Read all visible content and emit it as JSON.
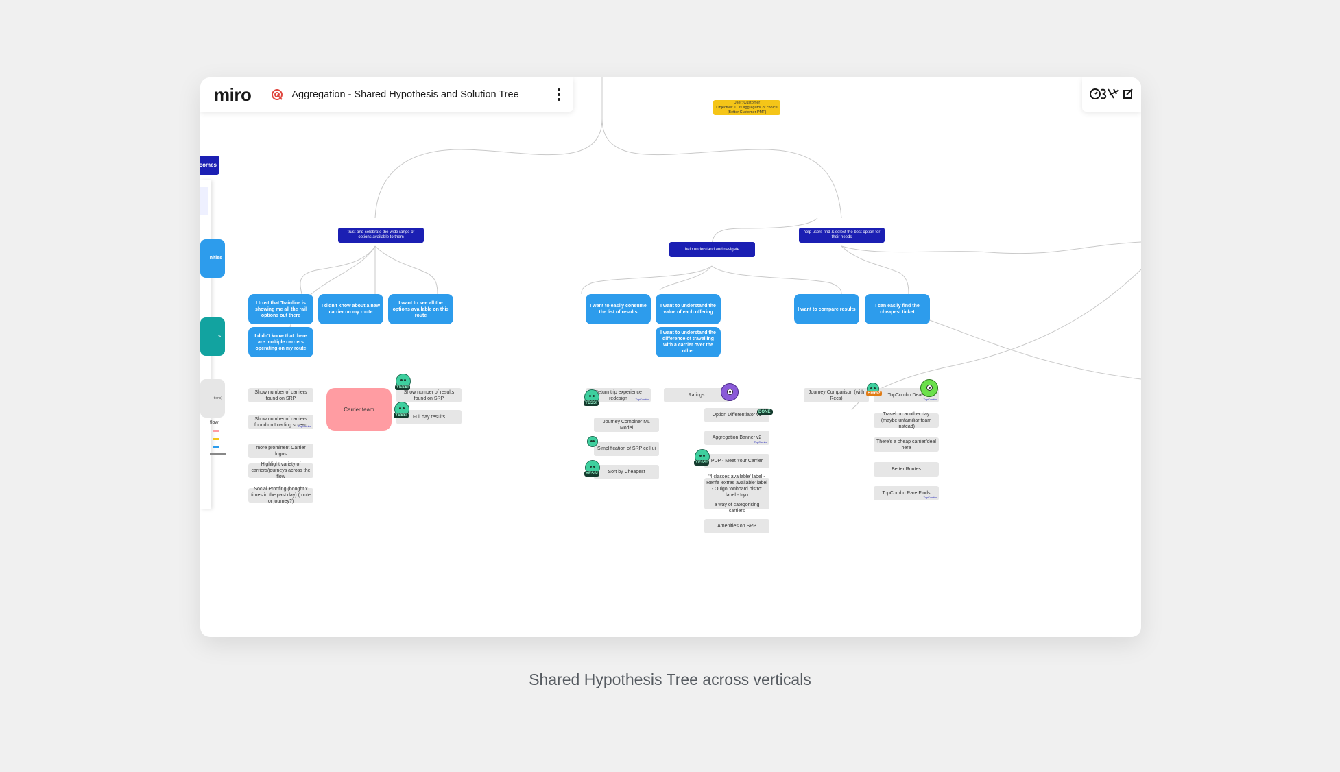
{
  "app": {
    "logo": "miro",
    "board_title": "Aggregation - Shared Hypothesis and Solution Tree",
    "board_icon": "board-icon",
    "menu_icon": "more-vertical-icon",
    "right_tool_icons": [
      "collaborators-icon",
      "share-icon"
    ]
  },
  "colors": {
    "outcome_navy": "#1b1fb3",
    "opportunity_blue": "#2d9cec",
    "root_yellow": "#f5c518",
    "solution_grey": "#e6e6e6",
    "team_pink": "#ff9ca2",
    "left_teal": "#12a3a0"
  },
  "tree": {
    "root": {
      "line1": "User: Customer",
      "line2": "Objective: TL is aggregator of choice",
      "line3": "(Better Customer PMF)"
    },
    "outcomes": {
      "trust": "trust and celebrate the wide range of options available to them",
      "navigate": "help understand and navigate",
      "select": "help users find & select the best option for their needs"
    },
    "opportunities": {
      "o1": "I trust that Trainline is showing me all the rail options out there",
      "o2": "I didn't know about a new carrier on my route",
      "o3": "I want to see all the options available on this route",
      "o4": "I didn't know that there are multiple carriers operating on my route",
      "o5": "I want to easily consume the list of results",
      "o6": "I want to understand the value of each offering",
      "o7": "I want to understand the difference of travelling with a carrier over the other",
      "o8": "I want to compare results",
      "o9": "I can easily find the cheapest ticket"
    },
    "solutions": {
      "s1": "Show number of carriers found on SRP",
      "s2": "Show number of carriers found on Loading screen",
      "s3": "more prominent Carrier logos",
      "s4": "Highlight variety of carriers/journeys across the flow",
      "s5": "Social Proofing (bought x times in the past day) (route or journey?)",
      "s6": "Carrier team",
      "s7": "Show number of results found on SRP",
      "s8": "Full day results",
      "s9": "Return trip experience redesign",
      "s10": "Journey Combiner ML Model",
      "s11": "Simplification of SRP cell ui",
      "s12": "Sort by Cheapest",
      "s13": "Ratings",
      "s14": "Option Differentiator v1",
      "s15": "Aggregation Banner v2",
      "s16": "PDP - Meet Your Carrier",
      "s17a": "'4 classes available' label - Renfe 'extras available' label - Ouigo \"onboard bistro' label - Iryo",
      "s17b": "a way of categorising carriers",
      "s18": "Amenities on SRP",
      "s19": "Journey Comparison (with Recs)",
      "s20": "TopCombo Deals",
      "s21": "Travel on another day (maybe unfamiliar team instead)",
      "s22": "There's a cheap carrier/deal here",
      "s23": "Better Routes",
      "s24": "TopCombo Rare Finds"
    },
    "tag": "TopCombo",
    "stickers": {
      "yes": "YESS!",
      "done": "DONE!",
      "hmm": "Hmm?"
    }
  },
  "left_panel": {
    "outcomes_label": "tcomes",
    "opportunities_label": "nities",
    "teal_label": "s",
    "grey_label": "tions)",
    "flow_label": "flow:"
  },
  "caption": "Shared Hypothesis Tree across verticals"
}
